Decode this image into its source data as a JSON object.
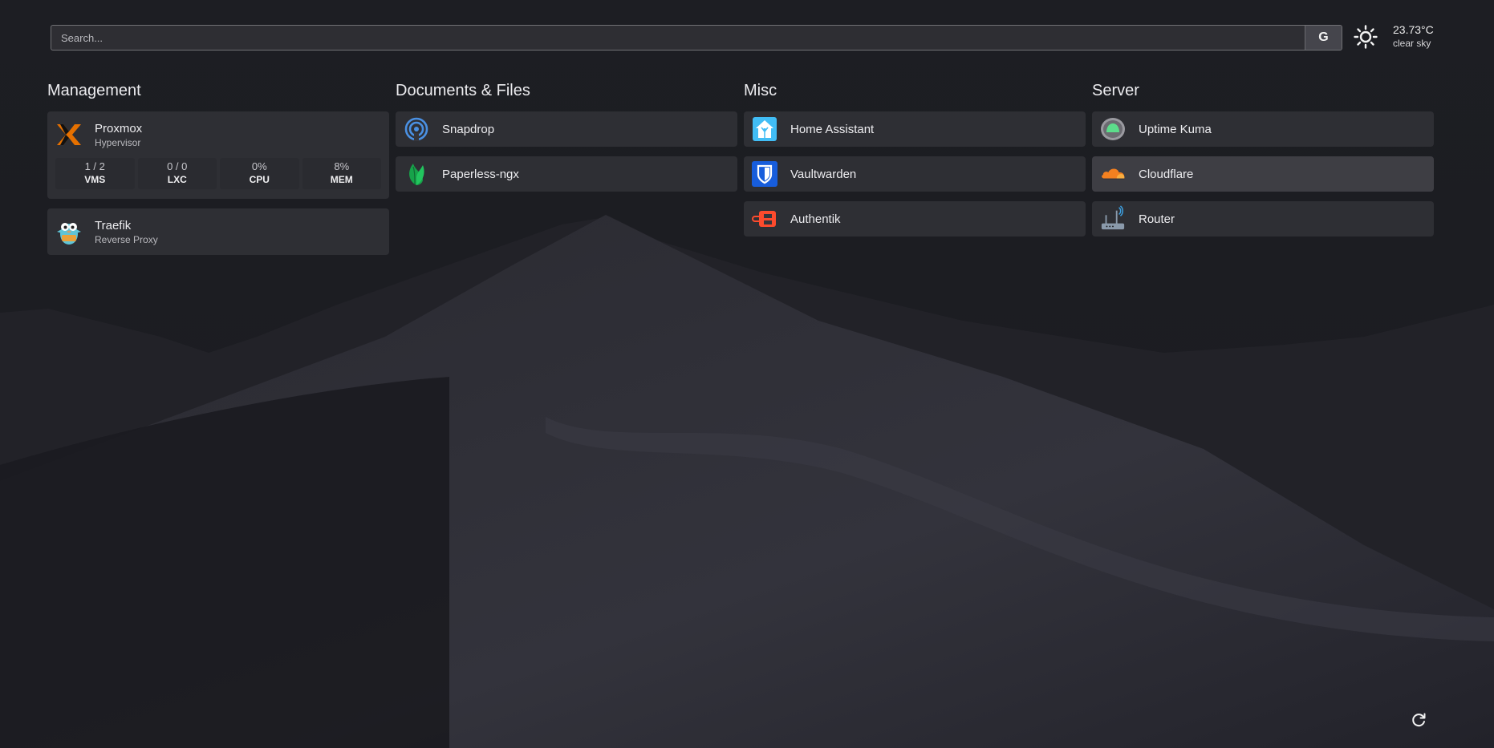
{
  "search": {
    "placeholder": "Search...",
    "engine_label": "G"
  },
  "weather": {
    "temperature": "23.73°C",
    "description": "clear sky",
    "icon": "sun-icon"
  },
  "groups": [
    {
      "title": "Management",
      "services": [
        {
          "name": "Proxmox",
          "description": "Hypervisor",
          "icon": "proxmox-icon",
          "stats": [
            {
              "value": "1 / 2",
              "label": "VMS"
            },
            {
              "value": "0 / 0",
              "label": "LXC"
            },
            {
              "value": "0%",
              "label": "CPU"
            },
            {
              "value": "8%",
              "label": "MEM"
            }
          ]
        },
        {
          "name": "Traefik",
          "description": "Reverse Proxy",
          "icon": "traefik-icon"
        }
      ]
    },
    {
      "title": "Documents & Files",
      "services": [
        {
          "name": "Snapdrop",
          "icon": "snapdrop-icon"
        },
        {
          "name": "Paperless-ngx",
          "icon": "paperless-leaf-icon"
        }
      ]
    },
    {
      "title": "Misc",
      "services": [
        {
          "name": "Home Assistant",
          "icon": "home-assistant-icon"
        },
        {
          "name": "Vaultwarden",
          "icon": "vaultwarden-shield-icon"
        },
        {
          "name": "Authentik",
          "icon": "authentik-icon"
        }
      ]
    },
    {
      "title": "Server",
      "services": [
        {
          "name": "Uptime Kuma",
          "icon": "uptime-kuma-icon"
        },
        {
          "name": "Cloudflare",
          "icon": "cloudflare-icon"
        },
        {
          "name": "Router",
          "icon": "router-icon"
        }
      ]
    }
  ],
  "colors": {
    "background": "#1c1c20",
    "card": "#36363c",
    "proxmox_orange": "#e57000",
    "cloudflare_orange": "#f38020",
    "vaultwarden_blue": "#175ddc",
    "authentik_red": "#fd4b2d",
    "paperless_green": "#17a34a",
    "snapdrop_blue": "#4a90e2"
  },
  "footer": {
    "refresh_icon": "refresh-icon"
  }
}
